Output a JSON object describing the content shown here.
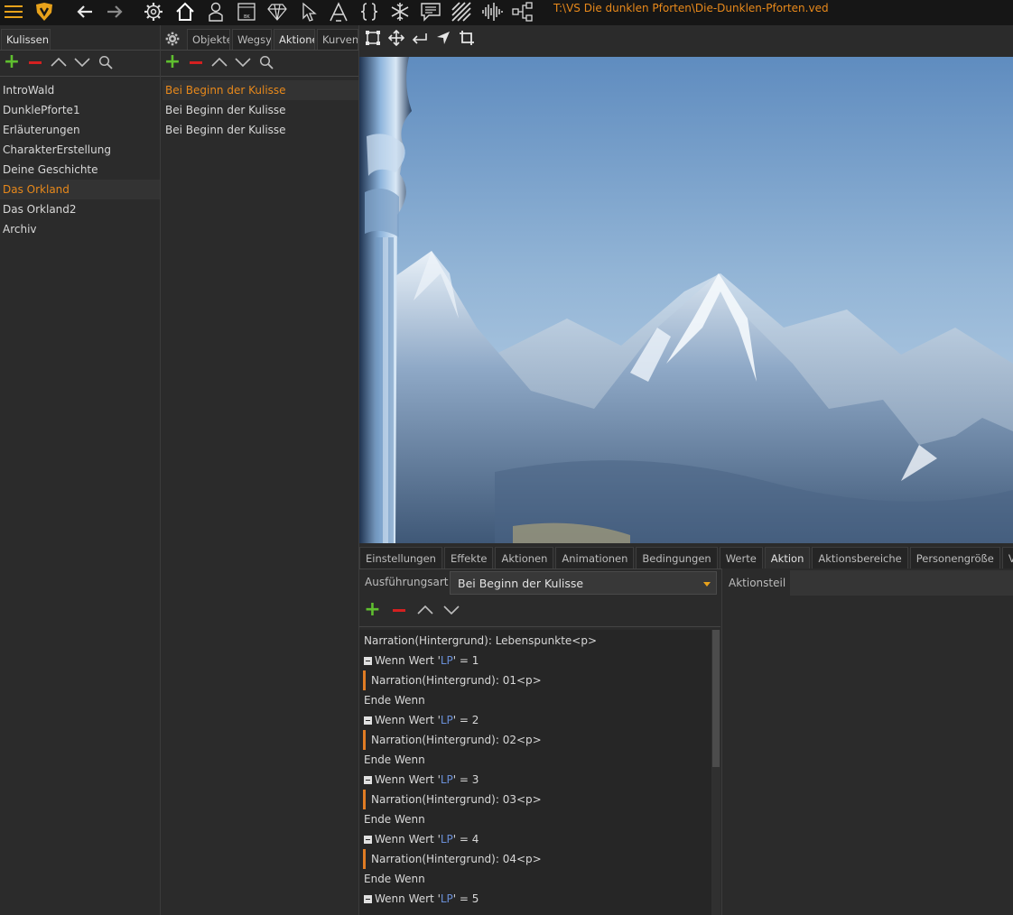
{
  "window_title": "T:\\VS Die dunklen Pforten\\Die-Dunklen-Pforten.ved",
  "toolbar": {
    "icons": [
      "menu-icon",
      "logo-icon",
      "back-arrow-icon",
      "forward-arrow-icon",
      "gear-icon",
      "home-icon",
      "person-icon",
      "bk-window-icon",
      "diamond-icon",
      "cursor-icon",
      "font-icon",
      "braces-icon",
      "snowflake-icon",
      "speech-bubble-icon",
      "hatch-icon",
      "waveform-icon",
      "network-icon"
    ],
    "bk_label": "BK"
  },
  "kulissen_panel": {
    "tab_label": "Kulissen",
    "items": [
      {
        "label": "IntroWald",
        "selected": false
      },
      {
        "label": "DunklePforte1",
        "selected": false
      },
      {
        "label": "Erläuterungen",
        "selected": false
      },
      {
        "label": "CharakterErstellung",
        "selected": false
      },
      {
        "label": "Deine Geschichte",
        "selected": false
      },
      {
        "label": "Das Orkland",
        "selected": true
      },
      {
        "label": "Das Orkland2",
        "selected": false
      },
      {
        "label": "Archiv",
        "selected": false
      }
    ]
  },
  "middle_panel": {
    "tabs": [
      {
        "label": "Objekte",
        "active": false
      },
      {
        "label": "Wegsys",
        "active": false
      },
      {
        "label": "Aktionen",
        "active": true
      },
      {
        "label": "Kurven",
        "active": false
      }
    ],
    "items": [
      {
        "label": "Bei Beginn der Kulisse",
        "selected": true
      },
      {
        "label": "Bei Beginn der Kulisse",
        "selected": false
      },
      {
        "label": "Bei Beginn der Kulisse",
        "selected": false
      }
    ]
  },
  "view_tools": [
    "select-rect-icon",
    "move-icon",
    "return-icon",
    "navigate-icon",
    "crop-icon"
  ],
  "bottom_tabs": [
    {
      "label": "Einstellungen",
      "active": false
    },
    {
      "label": "Effekte",
      "active": false
    },
    {
      "label": "Aktionen",
      "active": false
    },
    {
      "label": "Animationen",
      "active": false
    },
    {
      "label": "Bedingungen",
      "active": false
    },
    {
      "label": "Werte",
      "active": false
    },
    {
      "label": "Aktion",
      "active": true
    },
    {
      "label": "Aktionsbereiche",
      "active": false
    },
    {
      "label": "Personengröße",
      "active": false
    },
    {
      "label": "Vorschau",
      "active": false
    }
  ],
  "action_editor": {
    "execution_label": "Ausführungsart",
    "execution_value": "Bei Beginn der Kulisse",
    "aktionsteil_label": "Aktionsteil",
    "script_lines": [
      {
        "type": "plain",
        "text": "Narration(Hintergrund): Lebenspunkte<p>"
      },
      {
        "type": "if",
        "pre": "Wenn Wert '",
        "var": "LP",
        "post": "' = 1"
      },
      {
        "type": "inner",
        "text": "Narration(Hintergrund): 01<p>"
      },
      {
        "type": "plain",
        "text": "Ende Wenn"
      },
      {
        "type": "if",
        "pre": "Wenn Wert '",
        "var": "LP",
        "post": "' = 2"
      },
      {
        "type": "inner",
        "text": "Narration(Hintergrund): 02<p>"
      },
      {
        "type": "plain",
        "text": "Ende Wenn"
      },
      {
        "type": "if",
        "pre": "Wenn Wert '",
        "var": "LP",
        "post": "' = 3"
      },
      {
        "type": "inner",
        "text": "Narration(Hintergrund): 03<p>"
      },
      {
        "type": "plain",
        "text": "Ende Wenn"
      },
      {
        "type": "if",
        "pre": "Wenn Wert '",
        "var": "LP",
        "post": "' = 4"
      },
      {
        "type": "inner",
        "text": "Narration(Hintergrund): 04<p>"
      },
      {
        "type": "plain",
        "text": "Ende Wenn"
      },
      {
        "type": "if",
        "pre": "Wenn Wert '",
        "var": "LP",
        "post": "' = 5"
      }
    ]
  },
  "colors": {
    "accent": "#e8891b",
    "add_green": "#5fbf2f",
    "remove_red": "#d42020",
    "variable_blue": "#6a8fd8",
    "block_bar": "#e07c24"
  }
}
